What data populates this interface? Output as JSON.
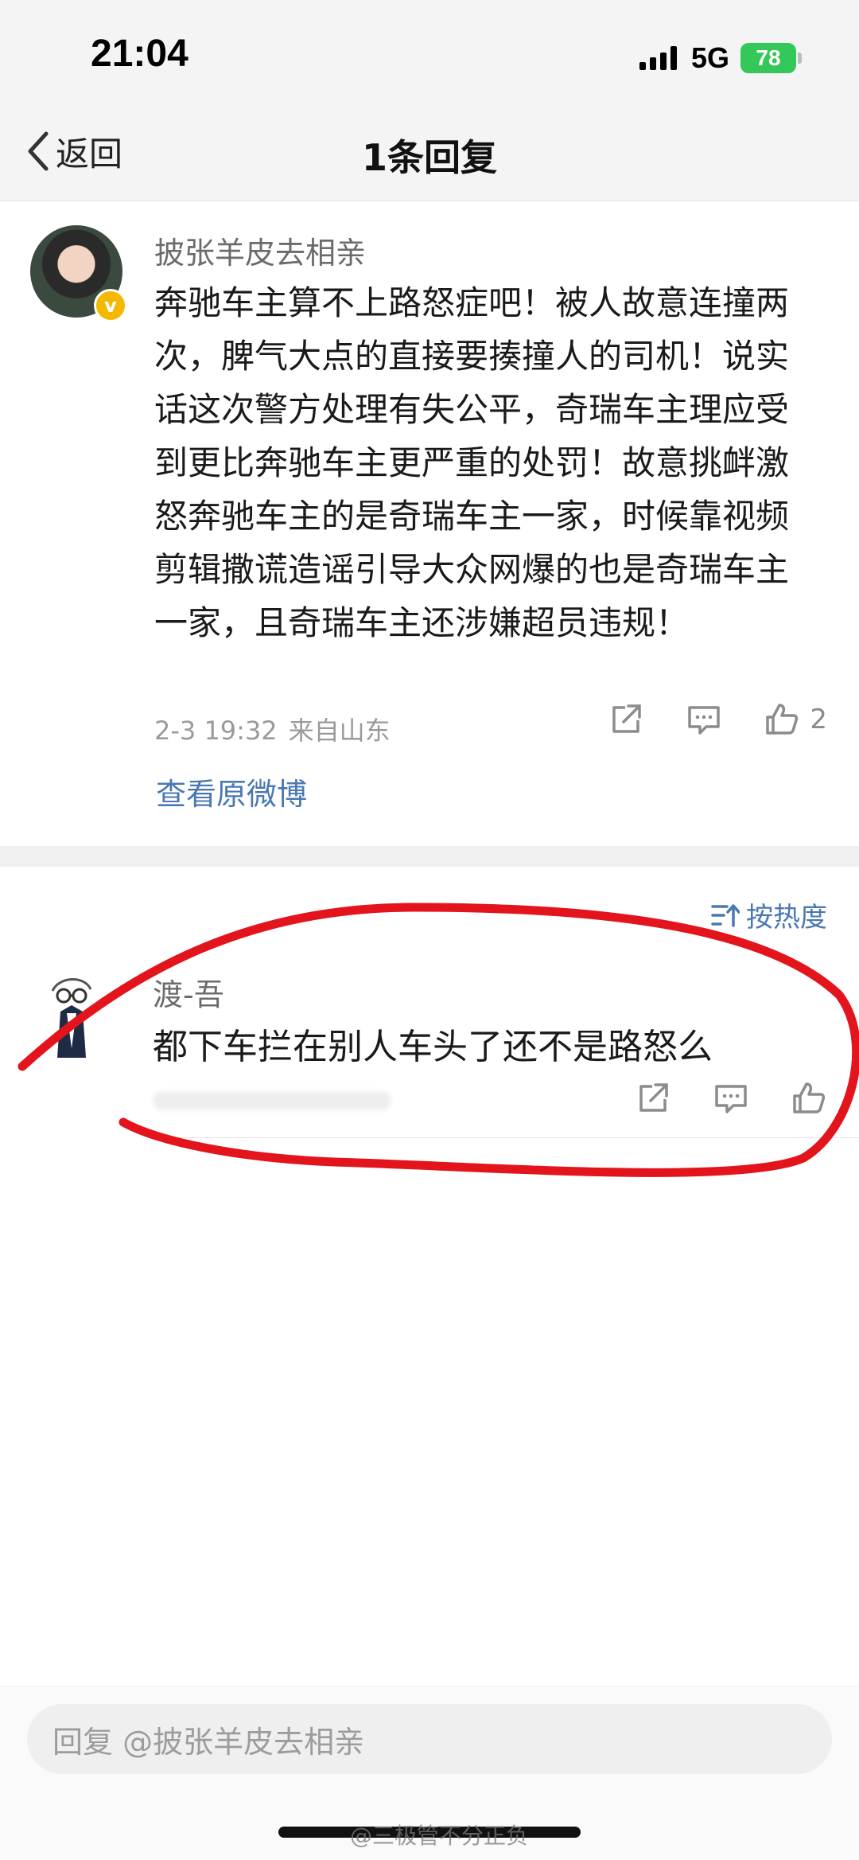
{
  "status_bar": {
    "time": "21:04",
    "network": "5G",
    "battery": "78"
  },
  "nav": {
    "back_label": "返回",
    "title": "1条回复"
  },
  "post": {
    "author": "披张羊皮去相亲",
    "verified": true,
    "text": "奔驰车主算不上路怒症吧！被人故意连撞两次，脾气大点的直接要揍撞人的司机！说实话这次警方处理有失公平，奇瑞车主理应受到更比奔驰车主更严重的处罚！故意挑衅激怒奔驰车主的是奇瑞车主一家，时候靠视频剪辑撒谎造谣引导大众网爆的也是奇瑞车主一家，且奇瑞车主还涉嫌超员违规！",
    "date": "2-3 19:32",
    "location": "来自山东",
    "like_count": "2",
    "view_original": "查看原微博"
  },
  "replies": {
    "sort_label": "按热度",
    "items": [
      {
        "author": "渡-吾",
        "text": "都下车拦在别人车头了还不是路怒么"
      }
    ]
  },
  "reply_box": {
    "placeholder": "回复 @披张羊皮去相亲"
  },
  "watermark": "@三极管不分正负",
  "colors": {
    "link_blue": "#4a78b3",
    "annotation_red": "#e3141c",
    "battery_green": "#34c759",
    "verified_gold": "#f5b800"
  }
}
